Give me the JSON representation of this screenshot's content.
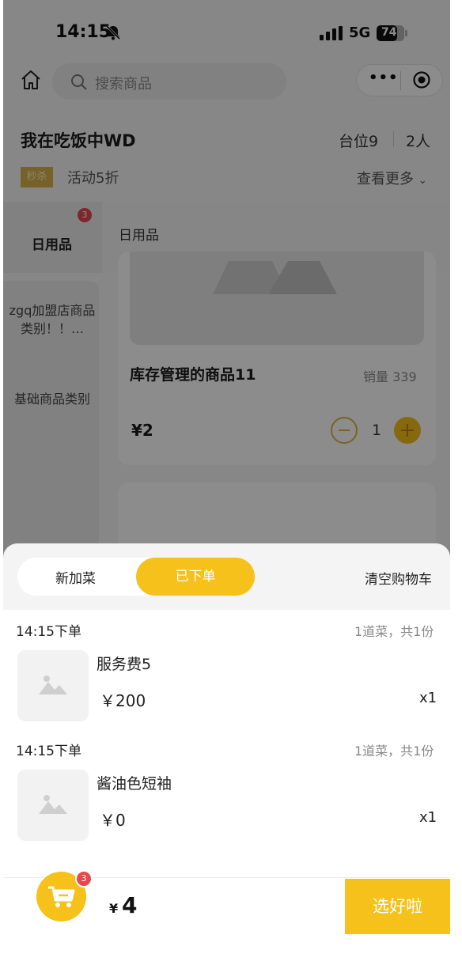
{
  "status_bar": {
    "time": "14:15",
    "network": "5G",
    "battery": "74"
  },
  "search": {
    "placeholder": "搜索商品"
  },
  "store": {
    "name": "我在吃饭中WD",
    "table": "台位9",
    "people": "2人"
  },
  "promo": {
    "badge": "秒杀",
    "text": "活动5折",
    "more": "查看更多"
  },
  "categories": {
    "left_label": "日用品",
    "left_badge": "3",
    "right_label": "日用品",
    "sidebar": [
      "zgq加盟店商品类别！！…",
      "基础商品类别"
    ]
  },
  "product": {
    "name": "库存管理的商品11",
    "sales": "销量 339",
    "price": "¥2",
    "qty": "1"
  },
  "sheet": {
    "tab_new": "新加菜",
    "tab_ordered": "已下单",
    "clear": "清空购物车",
    "orders": [
      {
        "time": "14:15下单",
        "count": "1道菜，共1份",
        "item": "服务费5",
        "price": "￥200",
        "qty": "x1"
      },
      {
        "time": "14:15下单",
        "count": "1道菜，共1份",
        "item": "酱油色短袖",
        "price": "￥0",
        "qty": "x1"
      }
    ]
  },
  "footer": {
    "cart_badge": "3",
    "currency": "¥",
    "total": "4",
    "submit": "选好啦"
  },
  "colors": {
    "accent": "#f6c11a",
    "badge": "#e5484d"
  },
  "icons": [
    "home-icon",
    "search-icon",
    "more-icon",
    "target-icon",
    "bell-off-icon",
    "cart-icon",
    "image-placeholder-icon"
  ]
}
